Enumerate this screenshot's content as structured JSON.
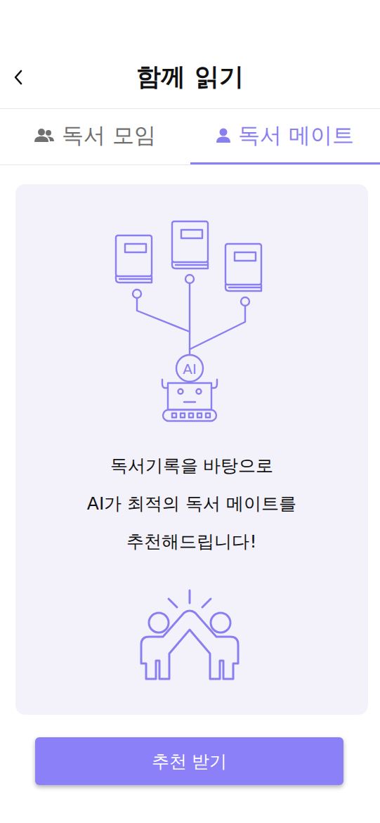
{
  "header": {
    "title": "함께 읽기"
  },
  "tabs": [
    {
      "label": "독서 모임",
      "selected": false,
      "kind": "group"
    },
    {
      "label": "독서 메이트",
      "selected": true,
      "kind": "person"
    }
  ],
  "card": {
    "robot_label": "AI",
    "message": [
      "독서기록을 바탕으로",
      "AI가 최적의 독서 메이트를",
      "추천해드립니다!"
    ]
  },
  "button": {
    "label": "추천 받기"
  }
}
